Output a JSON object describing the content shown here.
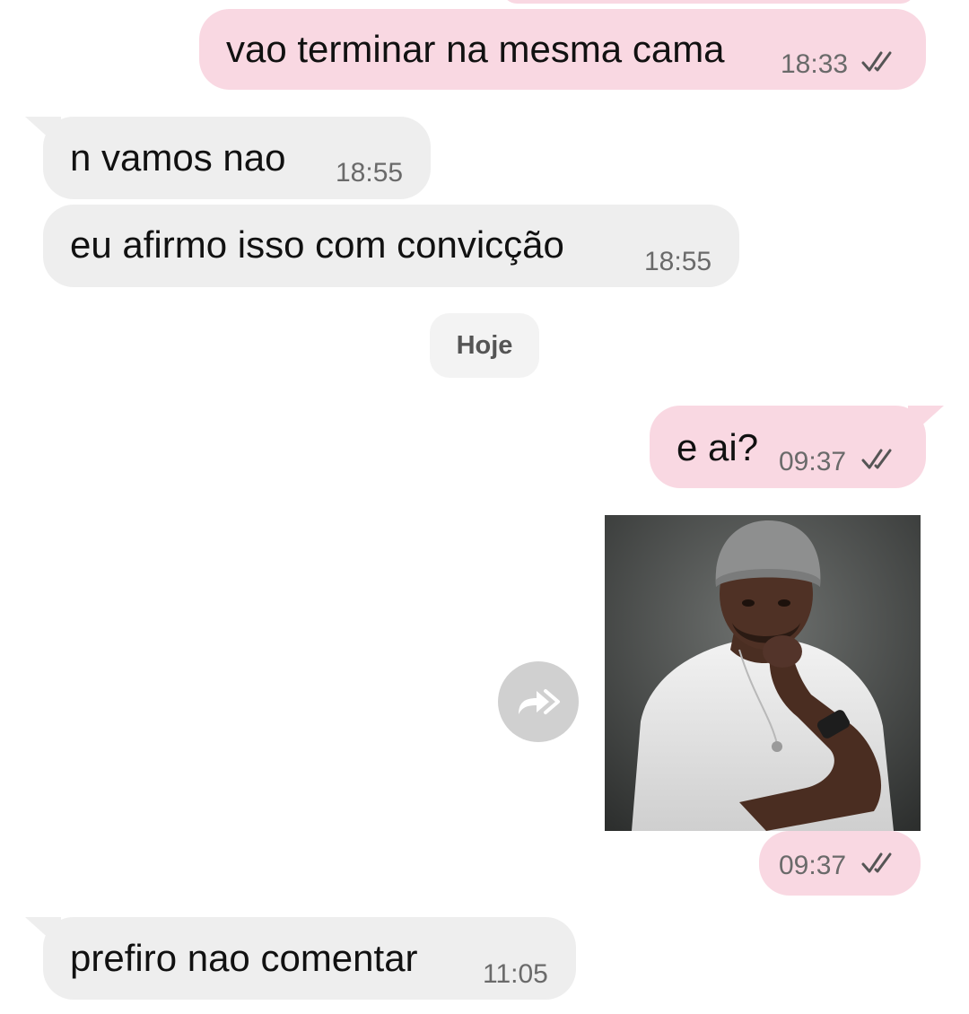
{
  "messages": [
    {
      "text": "vao terminar na mesma cama",
      "time": "18:33",
      "direction": "outgoing",
      "status": "read"
    },
    {
      "text": "n vamos nao",
      "time": "18:55",
      "direction": "incoming"
    },
    {
      "text": "eu afirmo isso com convicção",
      "time": "18:55",
      "direction": "incoming"
    },
    {
      "text": "e ai?",
      "time": "09:37",
      "direction": "outgoing",
      "status": "read"
    },
    {
      "text": "",
      "time": "09:37",
      "direction": "outgoing",
      "type": "image",
      "status": "read"
    },
    {
      "text": "prefiro nao comentar",
      "time": "11:05",
      "direction": "incoming"
    }
  ],
  "date_separator": "Hoje",
  "icons": {
    "read_receipt": "double-check-icon",
    "forward": "forward-icon"
  },
  "colors": {
    "outgoing_bubble": "#f9d8e2",
    "incoming_bubble": "#eeeeee",
    "date_chip": "#f3f3f3",
    "forward_button": "#d0d0d0"
  }
}
